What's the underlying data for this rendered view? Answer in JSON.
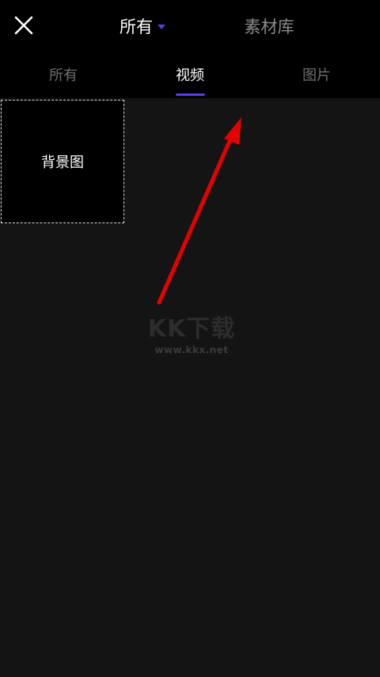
{
  "header": {
    "source_label": "所有",
    "library_label": "素材库"
  },
  "tabs": [
    {
      "label": "所有",
      "active": false
    },
    {
      "label": "视频",
      "active": true
    },
    {
      "label": "图片",
      "active": false
    }
  ],
  "grid": {
    "items": [
      {
        "label": "背景图"
      }
    ]
  },
  "watermark": {
    "logo": "KK下载",
    "url": "www.kkx.net"
  },
  "colors": {
    "accent": "#5b3cf5",
    "annotation_arrow": "#e60000",
    "background": "#141414",
    "bar": "#000000"
  },
  "icons": {
    "close": "close-icon",
    "caret": "caret-down-icon"
  }
}
